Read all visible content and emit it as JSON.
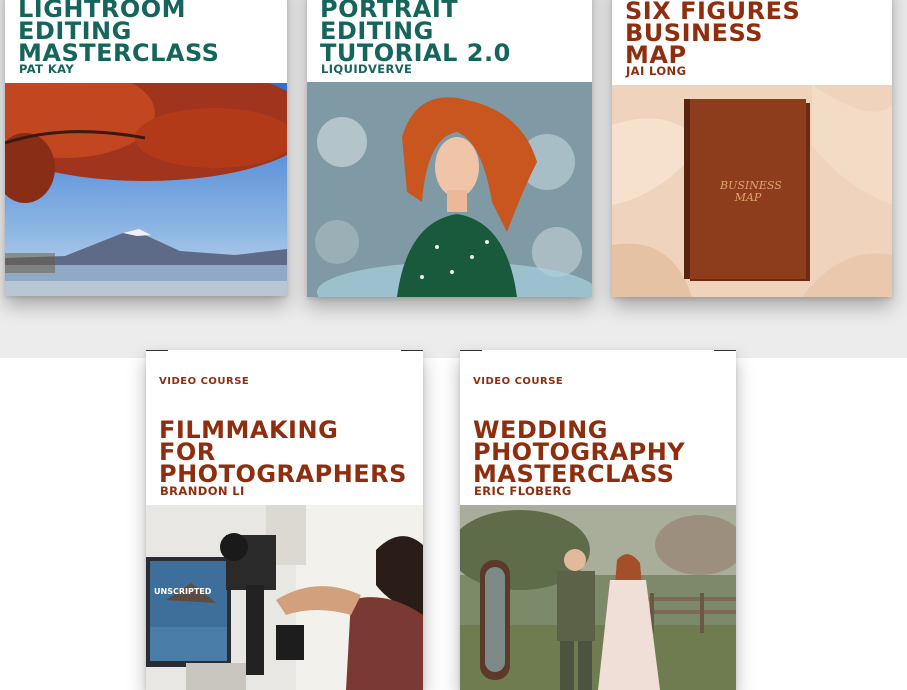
{
  "courses_top": [
    {
      "title_lines": [
        "LIGHTROOM",
        "EDITING",
        "MASTERCLASS"
      ],
      "author": "PAT KAY"
    },
    {
      "title_lines": [
        "PORTRAIT",
        "EDITING",
        "TUTORIAL 2.0"
      ],
      "author": "LIQUIDVERVE"
    },
    {
      "title_lines": [
        "SIX FIGURES",
        "BUSINESS",
        "MAP"
      ],
      "author": "JAI LONG",
      "cover_text": "BUSINESS MAP"
    }
  ],
  "courses_bottom": [
    {
      "tag": "VIDEO COURSE",
      "title_lines": [
        "FILMMAKING",
        "FOR",
        "PHOTOGRAPHERS"
      ],
      "author": "BRANDON LI",
      "screen_text": "UNSCRIPTED"
    },
    {
      "tag": "VIDEO COURSE",
      "title_lines": [
        "WEDDING",
        "PHOTOGRAPHY",
        "MASTERCLASS"
      ],
      "author": "ERIC FLOBERG"
    }
  ],
  "colors": {
    "teal": "#15655d",
    "rust": "#8f2e0f",
    "band": "#ececec"
  }
}
